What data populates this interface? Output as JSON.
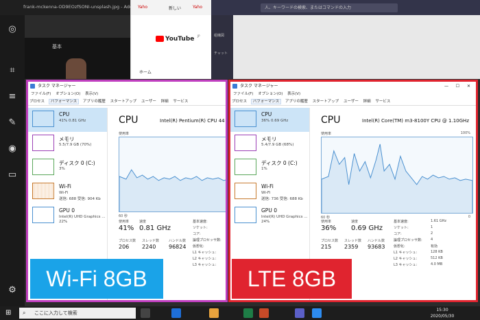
{
  "top": {
    "photo_tab": "frank-mckenna-OD9EOzfSONI-unsplash.jpg - Adobe P",
    "tab1": "Yaho",
    "tab2": "新しい",
    "tab3": "Yaho",
    "teams_search": "人、キーワードの検索、またはコマンドの入力",
    "photo_basic": "基本",
    "youtube": "YouTube",
    "youtube_sup": "JP",
    "home": "ホーム",
    "teams_item1": "組織図",
    "teams_item2": "チャット"
  },
  "left_window": {
    "title": "タスク マネージャー",
    "menu": [
      "ファイル(F)",
      "オプション(O)",
      "表示(V)"
    ],
    "tabs": [
      "プロセス",
      "パフォーマンス",
      "アプリの履歴",
      "スタートアップ",
      "ユーザー",
      "詳細",
      "サービス"
    ],
    "side": [
      {
        "name": "CPU",
        "sub": "41%  0.81 GHz",
        "sub2": ""
      },
      {
        "name": "メモリ",
        "sub": "5.5/7.9 GB (70%)",
        "sub2": ""
      },
      {
        "name": "ディスク 0 (C:)",
        "sub": "3%",
        "sub2": ""
      },
      {
        "name": "Wi-Fi",
        "sub": "Wi-Fi",
        "sub2": "送信: 688  受信: 904 Kb"
      },
      {
        "name": "GPU 0",
        "sub": "Intel(R) UHD Graphics ...",
        "sub2": "22%"
      }
    ],
    "main_title": "CPU",
    "model": "Intel(R) Pentium(R) CPU 44",
    "usage_label": "使用率",
    "seconds": "60 秒",
    "stats": {
      "usage_label": "使用率",
      "usage": "41%",
      "speed_label": "速度",
      "speed": "0.81 GHz",
      "proc_label": "プロセス数",
      "proc": "206",
      "thread_label": "スレッド数",
      "thread": "2240",
      "handle_label": "ハンドル数",
      "handle": "96824"
    },
    "right_keys": [
      "基本速度:",
      "ソケット:",
      "コア:",
      "論理プロセッサ数:",
      "仮想化:",
      "L1 キャッシュ:",
      "L2 キャッシュ:",
      "L3 キャッシュ:"
    ],
    "badge": "Wi-Fi 8GB"
  },
  "right_window": {
    "title": "タスク マネージャー",
    "menu": [
      "ファイル(F)",
      "オプション(O)",
      "表示(V)"
    ],
    "tabs": [
      "プロセス",
      "パフォーマンス",
      "アプリの履歴",
      "スタートアップ",
      "ユーザー",
      "詳細",
      "サービス"
    ],
    "side": [
      {
        "name": "CPU",
        "sub": "36%  0.69 GHz",
        "sub2": ""
      },
      {
        "name": "メモリ",
        "sub": "5.4/7.9 GB (68%)",
        "sub2": ""
      },
      {
        "name": "ディスク 0 (C:)",
        "sub": "1%",
        "sub2": ""
      },
      {
        "name": "Wi-Fi",
        "sub": "Wi-Fi",
        "sub2": "送信: 736  受信: 688 Kb"
      },
      {
        "name": "GPU 0",
        "sub": "Intel(R) UHD Graphics ...",
        "sub2": "24%"
      }
    ],
    "main_title": "CPU",
    "model": "Intel(R) Core(TM) m3-8100Y CPU @ 1.10GHz",
    "usage_label": "使用率",
    "pct_label": "100%",
    "seconds": "60 秒",
    "zero": "0",
    "stats": {
      "usage_label": "使用率",
      "usage": "36%",
      "speed_label": "速度",
      "speed": "0.69 GHz",
      "proc_label": "プロセス数",
      "proc": "215",
      "thread_label": "スレッド数",
      "thread": "2359",
      "handle_label": "ハンドル数",
      "handle": "93683"
    },
    "right_keys": [
      "基本速度:",
      "ソケット:",
      "コア:",
      "論理プロセッサ数:",
      "仮想化:",
      "L1 キャッシュ:",
      "L2 キャッシュ:",
      "L3 キャッシュ:"
    ],
    "right_vals": [
      "1.61 GHz",
      "1",
      "2",
      "4",
      "有効",
      "128 KB",
      "512 KB",
      "4.0 MB"
    ],
    "badge": "LTE 8GB"
  },
  "taskbar": {
    "search_placeholder": "ここに入力して検索",
    "time": "15:30",
    "date": "2020/05/30"
  },
  "colors": {
    "left_border": "#c03fbf",
    "right_border": "#e0242f",
    "left_badge": "#1aa3e8",
    "right_badge": "#e0242f",
    "cpu_line": "#4a90d0"
  }
}
